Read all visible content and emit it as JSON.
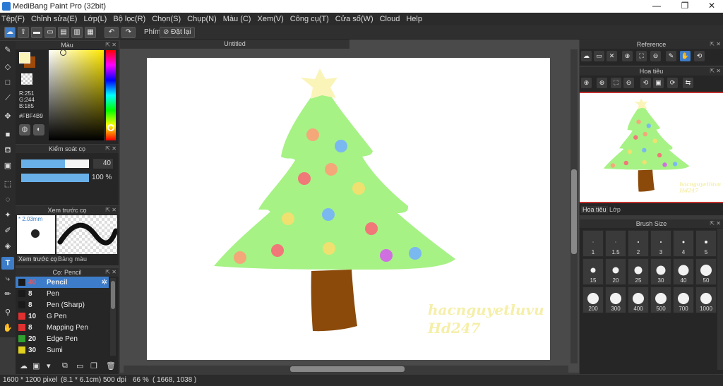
{
  "app": {
    "title": "MediBang Paint Pro (32bit)"
  },
  "window_controls": {
    "minimize": "—",
    "maximize": "❐",
    "close": "✕"
  },
  "menu": [
    "Tệp(F)",
    "Chỉnh sửa(E)",
    "Lớp(L)",
    "Bộ lọc(R)",
    "Chọn(S)",
    "Chụp(N)",
    "Màu (C)",
    "Xem(V)",
    "Công cụ(T)",
    "Cửa sổ(W)",
    "Cloud",
    "Help"
  ],
  "toolbar": {
    "phim_label": "Phím",
    "reset_label": "Đặt lại"
  },
  "color_panel": {
    "title": "Màu",
    "r": "R:251",
    "g": "G:244",
    "b": "B:185",
    "hex": "#FBF4B9",
    "fg_color": "#FBF4B9"
  },
  "brush_control": {
    "title": "Kiểm soát cọ",
    "size_value": "40",
    "opacity_value": "100 %",
    "size_fraction": 0.65,
    "opacity_fraction": 1.0
  },
  "brush_preview": {
    "title": "Xem trước cọ",
    "size_text": "* 2.03mm",
    "tab_preview": "Xem trước cọ",
    "tab_palette": "Bảng màu"
  },
  "brush_list": {
    "title": "Cọ: Pencil",
    "items": [
      {
        "size": "40",
        "name": "Pencil",
        "color": "#1a1a1a",
        "selected": true
      },
      {
        "size": "8",
        "name": "Pen",
        "color": "#1a1a1a"
      },
      {
        "size": "8",
        "name": "Pen (Sharp)",
        "color": "#1a1a1a"
      },
      {
        "size": "10",
        "name": "G Pen",
        "color": "#e03030"
      },
      {
        "size": "8",
        "name": "Mapping Pen",
        "color": "#e03030"
      },
      {
        "size": "20",
        "name": "Edge Pen",
        "color": "#30a030"
      },
      {
        "size": "30",
        "name": "Sumi",
        "color": "#e0d020"
      }
    ]
  },
  "canvas": {
    "tab_title": "Untitled",
    "watermark_line1": "hacnguyetluvu",
    "watermark_line2": "Hd247"
  },
  "reference_panel": {
    "title": "Reference"
  },
  "navigator_panel": {
    "title": "Hoa tiêu",
    "tab_navigator": "Hoa tiêu",
    "tab_layer": "Lớp",
    "watermark_line1": "hacnguyetluvu",
    "watermark_line2": "Hd247"
  },
  "brush_size_panel": {
    "title": "Brush Size",
    "sizes": [
      "1",
      "1.5",
      "2",
      "3",
      "4",
      "5",
      "15",
      "20",
      "25",
      "30",
      "40",
      "50",
      "200",
      "300",
      "400",
      "500",
      "700",
      "1000"
    ]
  },
  "status": {
    "pixels": "1600 * 1200 pixel",
    "cm": "(8.1 * 6.1cm)",
    "dpi": "500 dpi",
    "zoom": "66 %",
    "coords": "( 1668, 1038 )"
  },
  "icons": [
    "brush-icon",
    "eraser-icon",
    "rect-icon",
    "pen-line-icon",
    "move-icon",
    "fill-rect-icon",
    "bucket-icon",
    "gradient-icon",
    "select-rect-icon",
    "lasso-icon",
    "magic-wand-icon",
    "select-pen-icon",
    "select-eraser-icon",
    "text-icon",
    "hand-icon"
  ],
  "colors": {
    "tree": "#a6f285",
    "trunk": "#8b4a0a",
    "star": "#fbf4b9",
    "watermark": "#f5efaa"
  }
}
